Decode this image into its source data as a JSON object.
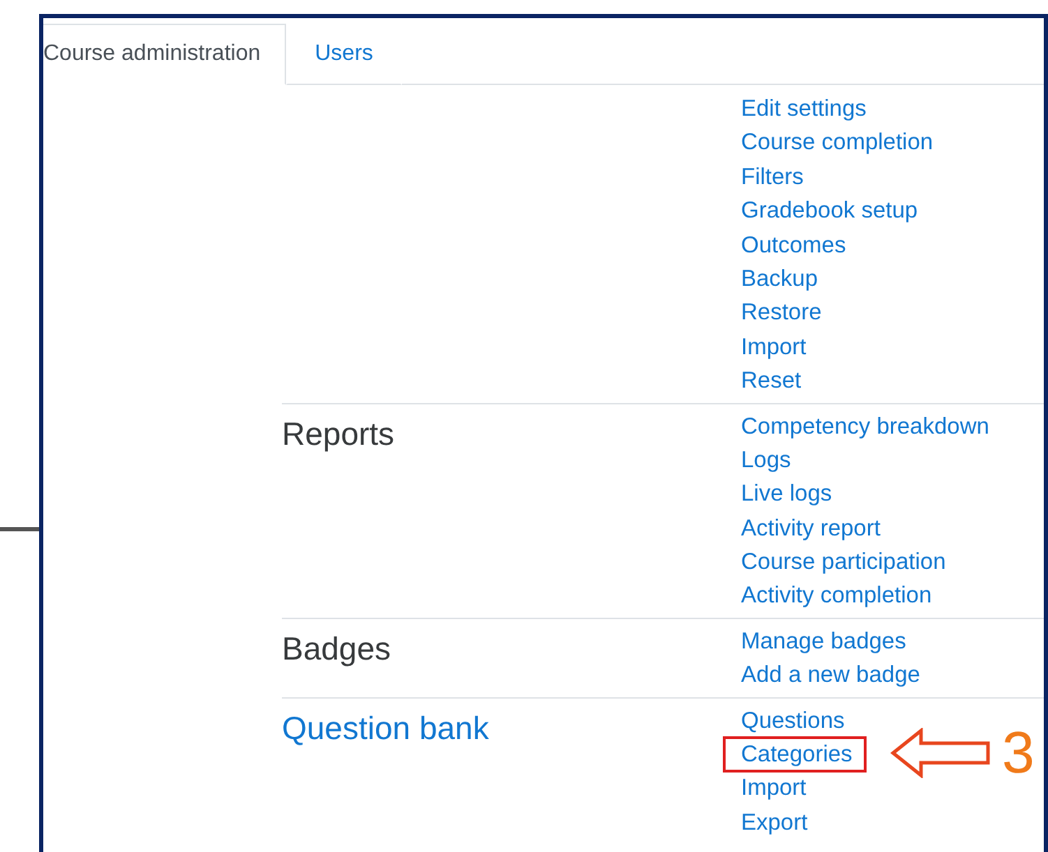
{
  "tabs": [
    {
      "label": "Course administration",
      "selected": true
    },
    {
      "label": "Users",
      "selected": false
    }
  ],
  "sections": [
    {
      "links": [
        {
          "label": "Edit settings",
          "highlighted": false
        },
        {
          "label": "Course completion",
          "highlighted": false
        },
        {
          "label": "Filters",
          "highlighted": false
        },
        {
          "label": "Gradebook setup",
          "highlighted": false
        },
        {
          "label": "Outcomes",
          "highlighted": false
        },
        {
          "label": "Backup",
          "highlighted": false
        },
        {
          "label": "Restore",
          "highlighted": false
        },
        {
          "label": "Import",
          "highlighted": false
        },
        {
          "label": "Reset",
          "highlighted": false
        }
      ]
    },
    {
      "heading": {
        "label": "Reports",
        "kind": "text"
      },
      "links": [
        {
          "label": "Competency breakdown",
          "highlighted": false
        },
        {
          "label": "Logs",
          "highlighted": false
        },
        {
          "label": "Live logs",
          "highlighted": false
        },
        {
          "label": "Activity report",
          "highlighted": false
        },
        {
          "label": "Course participation",
          "highlighted": false
        },
        {
          "label": "Activity completion",
          "highlighted": false
        }
      ]
    },
    {
      "heading": {
        "label": "Badges",
        "kind": "text"
      },
      "links": [
        {
          "label": "Manage badges",
          "highlighted": false
        },
        {
          "label": "Add a new badge",
          "highlighted": false
        }
      ]
    },
    {
      "heading": {
        "label": "Question bank",
        "kind": "link"
      },
      "links": [
        {
          "label": "Questions",
          "highlighted": false
        },
        {
          "label": "Categories",
          "highlighted": true,
          "annotation": "3"
        },
        {
          "label": "Import",
          "highlighted": false
        },
        {
          "label": "Export",
          "highlighted": false
        }
      ]
    }
  ]
}
